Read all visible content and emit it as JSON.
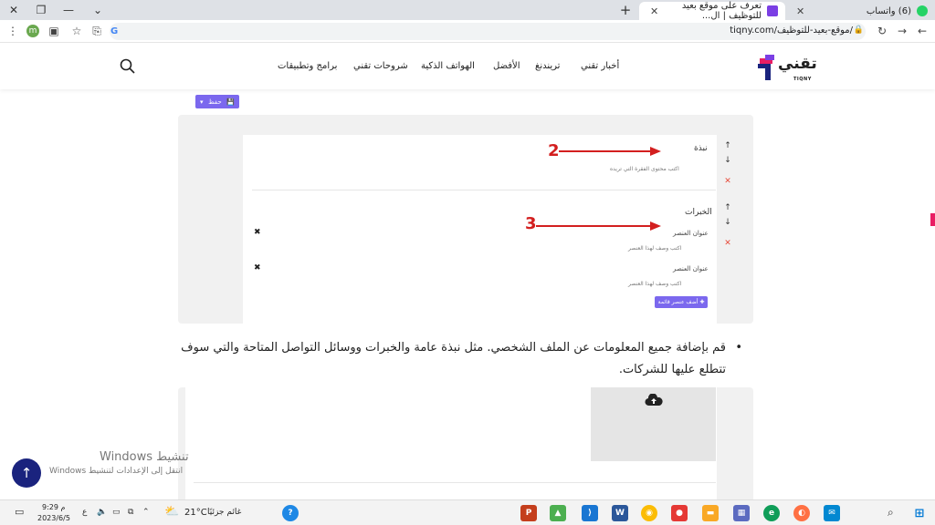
{
  "browser": {
    "active_tab": {
      "title": "تعرف على موقع بعيد للتوظيف | ال..."
    },
    "other_tab": {
      "title": "(6) واتساب"
    },
    "url": "tiqny.com/موقع-بعيد-للتوظيف/"
  },
  "site": {
    "logo_text": "تقني",
    "logo_sub": "TIQNY",
    "nav": [
      "أخبار تقني",
      "تريندنغ",
      "الأفضل",
      "الهواتف الذكية",
      "شروحات تقني",
      "برامج وتطبيقات"
    ]
  },
  "editor": {
    "save_label": "حفظ",
    "section1": {
      "title": "نبذة",
      "placeholder": "اكتب محتوى الفقرة التي تريده"
    },
    "section2": {
      "title": "الخبرات",
      "items": [
        {
          "title": "عنوان العنصر",
          "desc": "اكتب وصف لهذا العنصر"
        },
        {
          "title": "عنوان العنصر",
          "desc": "اكتب وصف لهذا العنصر"
        }
      ],
      "add_label": "أضف عنصر قائمة"
    },
    "annotations": [
      "2",
      "3"
    ]
  },
  "article": {
    "paragraph": "قم بإضافة جميع المعلومات عن الملف الشخصي. مثل نبذة عامة والخبرات ووسائل التواصل المتاحة والتي سوف تتطلع عليها للشركات."
  },
  "windows_watermark": {
    "title": "تنشيط Windows",
    "subtitle": "انتقل إلى الإعدادات لتنشيط Windows"
  },
  "taskbar": {
    "time": "9:29 م",
    "date": "2023/6/5",
    "lang": "ع",
    "temperature": "21°C",
    "weather": "غائم جزئيًا"
  },
  "colors": {
    "accent": "#7b68ee",
    "annotation": "#d31f1f",
    "scroll_button": "#1a237e"
  }
}
